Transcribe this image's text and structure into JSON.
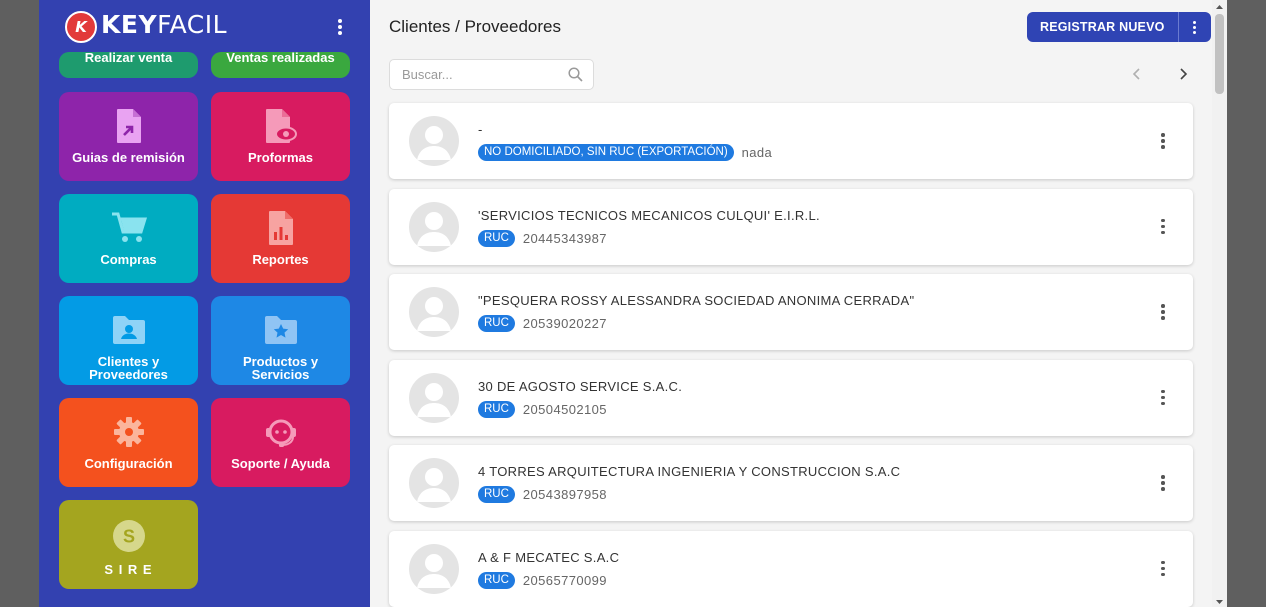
{
  "brand": {
    "mark": "K",
    "name_bold": "KEY",
    "name_light": "FACIL",
    "logo_color": "#e23a3a"
  },
  "sidebar": {
    "background": "#3341b0",
    "tiles": [
      {
        "id": "realizar-venta",
        "label": "Realizar venta",
        "color": "#1e9b6e",
        "icon": "cart-icon"
      },
      {
        "id": "ventas-realizadas",
        "label": "Ventas realizadas",
        "color": "#3aa83f",
        "icon": "receipt-icon"
      },
      {
        "id": "guias",
        "label": "Guias de remisión",
        "color": "#8e24aa",
        "icon": "document-arrow-icon"
      },
      {
        "id": "proformas",
        "label": "Proformas",
        "color": "#d81b60",
        "icon": "document-eye-icon"
      },
      {
        "id": "compras",
        "label": "Compras",
        "color": "#00acc1",
        "icon": "shopping-cart-icon"
      },
      {
        "id": "reportes",
        "label": "Reportes",
        "color": "#e53935",
        "icon": "report-chart-icon"
      },
      {
        "id": "clientes",
        "label": "Clientes y Proveedores",
        "color": "#039be5",
        "icon": "folder-user-icon"
      },
      {
        "id": "productos",
        "label": "Productos y Servicios",
        "color": "#1e88e5",
        "icon": "folder-star-icon"
      },
      {
        "id": "configuracion",
        "label": "Configuración",
        "color": "#f4511e",
        "icon": "gear-icon"
      },
      {
        "id": "soporte",
        "label": "Soporte / Ayuda",
        "color": "#d81b60",
        "icon": "support-agent-icon"
      },
      {
        "id": "sire",
        "label": "S I R E",
        "color": "#a4a51f",
        "icon": "sire-coin-icon"
      }
    ]
  },
  "main": {
    "title": "Clientes / Proveedores",
    "register_button": "REGISTRAR NUEVO",
    "search_placeholder": "Buscar...",
    "contacts": [
      {
        "name": "-",
        "doc_type": "NO DOMICILIADO, SIN RUC (EXPORTACIÓN)",
        "doc_number": "nada"
      },
      {
        "name": "'SERVICIOS TECNICOS MECANICOS CULQUI' E.I.R.L.",
        "doc_type": "RUC",
        "doc_number": "20445343987"
      },
      {
        "name": "\"PESQUERA ROSSY ALESSANDRA SOCIEDAD ANONIMA CERRADA\"",
        "doc_type": "RUC",
        "doc_number": "20539020227"
      },
      {
        "name": "30 DE AGOSTO SERVICE S.A.C.",
        "doc_type": "RUC",
        "doc_number": "20504502105"
      },
      {
        "name": "4 TORRES ARQUITECTURA INGENIERIA Y CONSTRUCCION S.A.C",
        "doc_type": "RUC",
        "doc_number": "20543897958"
      },
      {
        "name": "A & F MECATEC S.A.C",
        "doc_type": "RUC",
        "doc_number": "20565770099"
      }
    ]
  },
  "colors": {
    "primary_button": "#2f44b4",
    "badge": "#1f7ae0"
  }
}
